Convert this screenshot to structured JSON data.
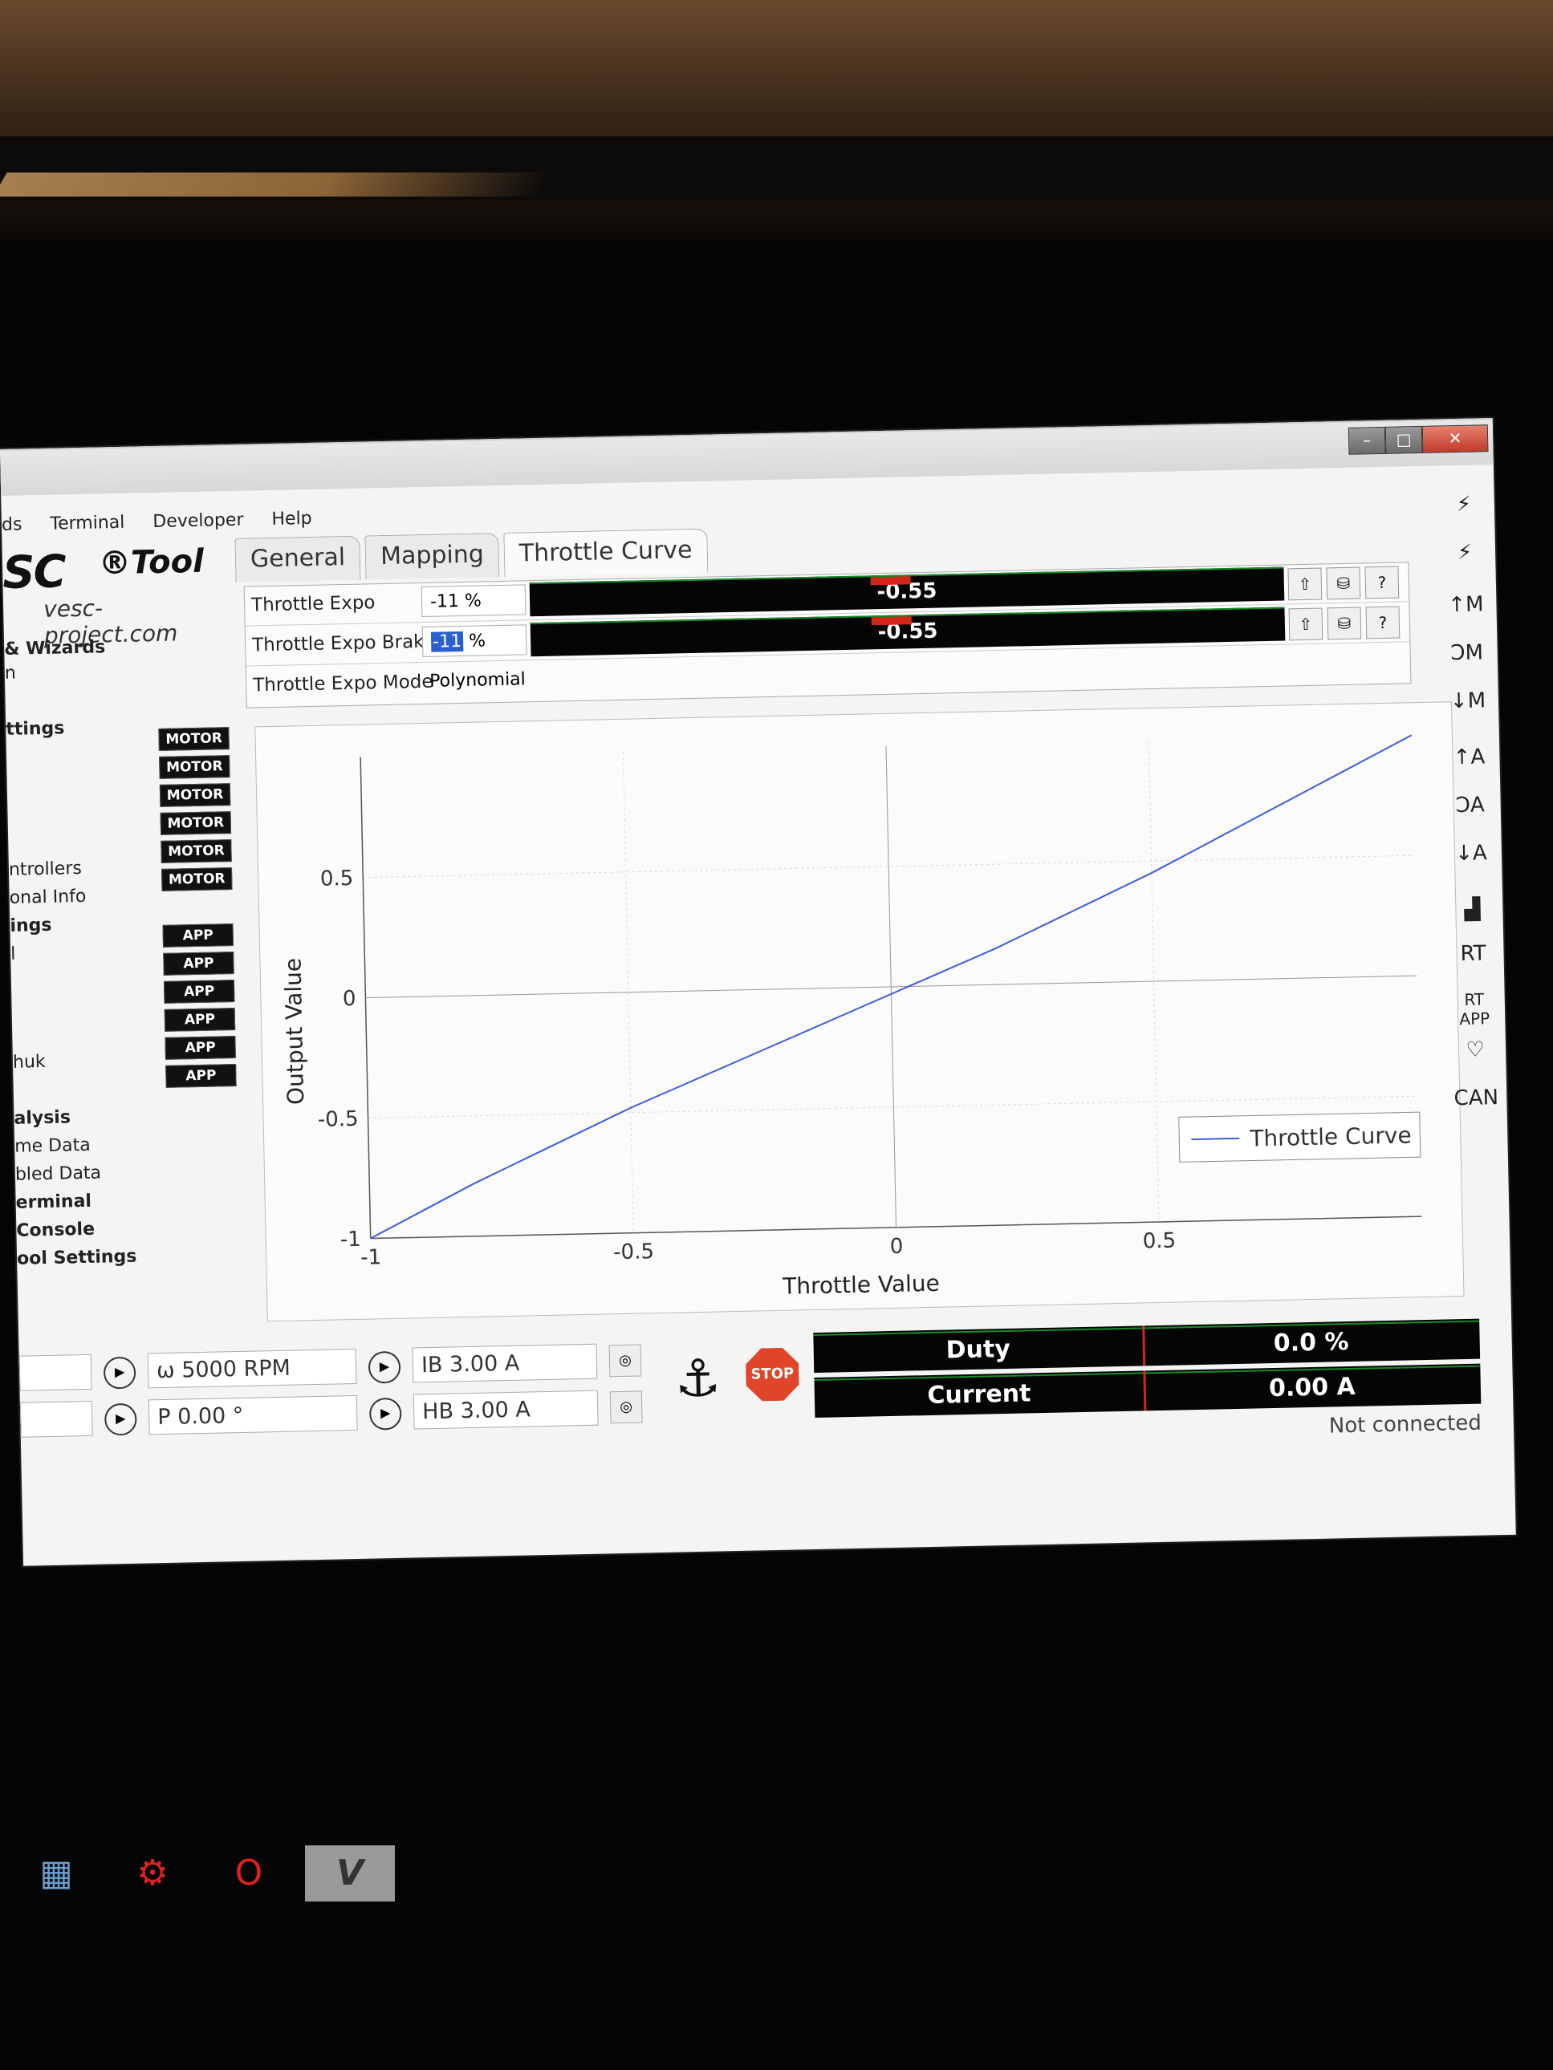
{
  "menu": [
    "ds",
    "Terminal",
    "Developer",
    "Help"
  ],
  "logo": {
    "mark": "SC",
    "tool": "®Tool",
    "url": "vesc-project.com"
  },
  "sidebar": [
    {
      "label": "& Wizards",
      "bold": true
    },
    {
      "label": "n",
      "bold": false
    },
    {
      "label": "ttings",
      "bold": true
    },
    {
      "label": "ntrollers",
      "bold": false
    },
    {
      "label": "onal Info",
      "bold": false
    },
    {
      "label": "ings",
      "bold": true
    },
    {
      "label": "l",
      "bold": false
    },
    {
      "label": "huk",
      "bold": false
    },
    {
      "label": "alysis",
      "bold": true
    },
    {
      "label": "me Data",
      "bold": false
    },
    {
      "label": "bled Data",
      "bold": false
    },
    {
      "label": "erminal",
      "bold": true
    },
    {
      "label": "Console",
      "bold": true
    },
    {
      "label": "ool Settings",
      "bold": true
    }
  ],
  "badges": {
    "motor": "MOTOR",
    "app": "APP"
  },
  "tabs": [
    "General",
    "Mapping",
    "Throttle Curve"
  ],
  "params": {
    "expo_label": "Throttle Expo",
    "expo_value": "-11 %",
    "expo_bar": "-0.55",
    "brake_label": "Throttle Expo Brake",
    "brake_value_sel": "-11",
    "brake_value_unit": " %",
    "brake_bar": "-0.55",
    "mode_label": "Throttle Expo Mode",
    "mode_value": "Polynomial"
  },
  "chart_data": {
    "type": "line",
    "xlabel": "Throttle Value",
    "ylabel": "Output Value",
    "xlim": [
      -1,
      1
    ],
    "ylim": [
      -1,
      1
    ],
    "xticks": [
      "-1",
      "-0.5",
      "0",
      "0.5"
    ],
    "yticks": [
      "-1",
      "-0.5",
      "0",
      "0.5"
    ],
    "grid": true,
    "legend": "bottom-right",
    "series": [
      {
        "name": "Throttle Curve",
        "color": "#3d5ce0",
        "x": [
          -1,
          -0.9,
          -0.8,
          -0.7,
          -0.6,
          -0.5,
          -0.4,
          -0.3,
          -0.2,
          -0.1,
          0,
          0.1,
          0.2,
          0.3,
          0.4,
          0.5,
          0.6,
          0.7,
          0.8,
          0.9,
          1
        ],
        "y": [
          -1,
          -0.89,
          -0.78,
          -0.68,
          -0.58,
          -0.48,
          -0.39,
          -0.3,
          -0.21,
          -0.12,
          -0.03,
          0.06,
          0.15,
          0.25,
          0.35,
          0.45,
          0.56,
          0.67,
          0.78,
          0.89,
          1
        ]
      }
    ]
  },
  "bottom": {
    "rpm": "ω 5000 RPM",
    "pos": "P 0.00 °",
    "ib": "IB 3.00 A",
    "hb": "HB 3.00 A",
    "stop": "STOP",
    "duty_label": "Duty",
    "duty_value": "0.0 %",
    "current_label": "Current",
    "current_value": "0.00 A",
    "status": "Not connected"
  },
  "right_toolbar": [
    "↑M",
    "ϽM",
    "↓M",
    "↑A",
    "ϽA",
    "↓A",
    "RT",
    "RT APP",
    "♡",
    "CAN"
  ]
}
